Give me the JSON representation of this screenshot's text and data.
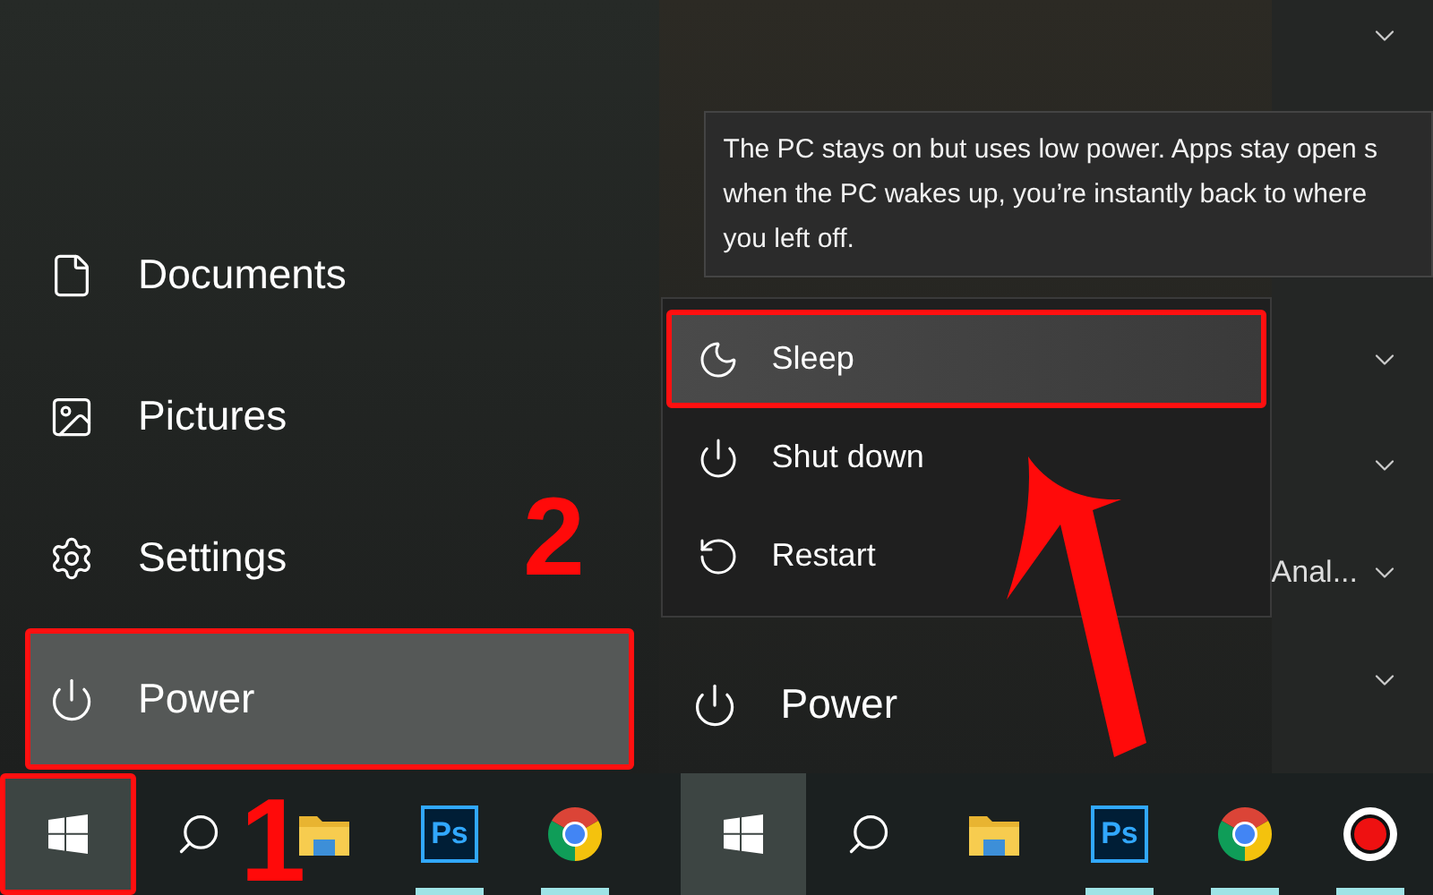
{
  "left_menu": {
    "items": [
      {
        "kind": "documents",
        "label": "Documents",
        "selected": false
      },
      {
        "kind": "pictures",
        "label": "Pictures",
        "selected": false
      },
      {
        "kind": "settings",
        "label": "Settings",
        "selected": false
      },
      {
        "kind": "power",
        "label": "Power",
        "selected": true
      }
    ],
    "step_number": "2"
  },
  "left_taskbar": {
    "step_number": "1",
    "icons": [
      {
        "kind": "start",
        "selected": true,
        "running": false
      },
      {
        "kind": "search",
        "selected": false,
        "running": false
      },
      {
        "kind": "explorer",
        "selected": false,
        "running": false
      },
      {
        "kind": "photoshop",
        "label": "Ps",
        "selected": false,
        "running": true
      },
      {
        "kind": "chrome",
        "selected": false,
        "running": true
      }
    ]
  },
  "right_menu": {
    "background_rows": [
      {
        "label": ""
      },
      {
        "label": ""
      },
      {
        "label": ""
      },
      {
        "label": "Anal..."
      },
      {
        "label": ""
      }
    ],
    "tooltip": [
      "The PC stays on but uses low power. Apps stay open s",
      "when the PC wakes up, you’re instantly back to where",
      "you left off."
    ],
    "power_options": [
      {
        "kind": "sleep",
        "label": "Sleep",
        "selected": true
      },
      {
        "kind": "shutdown",
        "label": "Shut down",
        "selected": false
      },
      {
        "kind": "restart",
        "label": "Restart",
        "selected": false
      }
    ],
    "power_item": {
      "label": "Power"
    }
  },
  "right_taskbar": {
    "icons": [
      {
        "kind": "start",
        "selected": true,
        "running": false
      },
      {
        "kind": "search",
        "selected": false,
        "running": false
      },
      {
        "kind": "explorer",
        "selected": false,
        "running": false
      },
      {
        "kind": "photoshop",
        "label": "Ps",
        "selected": false,
        "running": true
      },
      {
        "kind": "chrome",
        "selected": false,
        "running": true
      },
      {
        "kind": "record",
        "selected": false,
        "running": true
      }
    ]
  }
}
